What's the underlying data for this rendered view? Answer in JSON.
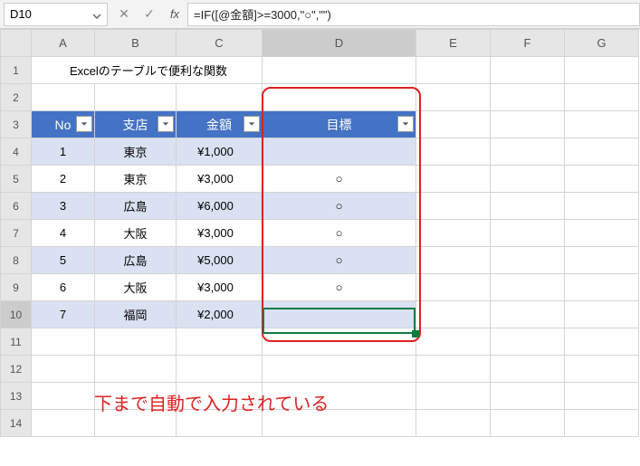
{
  "name_box": "D10",
  "formula": "=IF([@金額]>=3000,\"○\",\"\")",
  "col_headers": [
    "A",
    "B",
    "C",
    "D",
    "E",
    "F",
    "G"
  ],
  "row_headers": [
    "1",
    "2",
    "3",
    "4",
    "5",
    "6",
    "7",
    "8",
    "9",
    "10",
    "11",
    "12",
    "13",
    "14"
  ],
  "title": "Excelのテーブルで便利な関数",
  "table_headers": {
    "no": "No",
    "branch": "支店",
    "amount": "金額",
    "target": "目標"
  },
  "rows": [
    {
      "no": "1",
      "branch": "東京",
      "amount": "¥1,000",
      "target": ""
    },
    {
      "no": "2",
      "branch": "東京",
      "amount": "¥3,000",
      "target": "○"
    },
    {
      "no": "3",
      "branch": "広島",
      "amount": "¥6,000",
      "target": "○"
    },
    {
      "no": "4",
      "branch": "大阪",
      "amount": "¥3,000",
      "target": "○"
    },
    {
      "no": "5",
      "branch": "広島",
      "amount": "¥5,000",
      "target": "○"
    },
    {
      "no": "6",
      "branch": "大阪",
      "amount": "¥3,000",
      "target": "○"
    },
    {
      "no": "7",
      "branch": "福岡",
      "amount": "¥2,000",
      "target": ""
    }
  ],
  "annotation": "下まで自動で入力されている",
  "active_cell": "D10"
}
